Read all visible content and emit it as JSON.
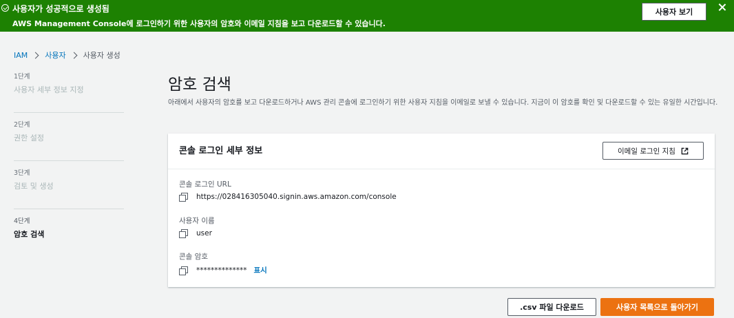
{
  "banner": {
    "title": "사용자가 성공적으로 생성됨",
    "message": "AWS Management Console에 로그인하기 위한 사용자의 암호와 이메일 지침을 보고 다운로드할 수 있습니다.",
    "view_user_button": "사용자 보기",
    "color": "#1d8102"
  },
  "breadcrumb": {
    "items": [
      "IAM",
      "사용자",
      "사용자 생성"
    ]
  },
  "steps": [
    {
      "number": "1단계",
      "label": "사용자 세부 정보 지정",
      "active": false
    },
    {
      "number": "2단계",
      "label": "권한 설정",
      "active": false
    },
    {
      "number": "3단계",
      "label": "검토 및 생성",
      "active": false
    },
    {
      "number": "4단계",
      "label": "암호 검색",
      "active": true
    }
  ],
  "page": {
    "title": "암호 검색",
    "description": "아래에서 사용자의 암호를 보고 다운로드하거나 AWS 관리 콘솔에 로그인하기 위한 사용자 지침을 이메일로 보낼 수 있습니다. 지금이 이 암호를 확인 및 다운로드할 수 있는 유일한 시간입니다."
  },
  "card": {
    "title": "콘솔 로그인 세부 정보",
    "email_button": "이메일 로그인 지침",
    "fields": {
      "url_label": "콘솔 로그인 URL",
      "url_value": "https://028416305040.signin.aws.amazon.com/console",
      "user_label": "사용자 이름",
      "user_value": "user",
      "password_label": "콘솔 암호",
      "password_value": "**************",
      "show_link": "표시"
    }
  },
  "footer": {
    "download_csv": ".csv 파일 다운로드",
    "return_button": "사용자 목록으로 돌아가기",
    "accent_color": "#ec7211"
  },
  "icons": [
    "check-circle-icon",
    "close-icon",
    "chevron-right-icon",
    "external-link-icon",
    "copy-icon"
  ]
}
